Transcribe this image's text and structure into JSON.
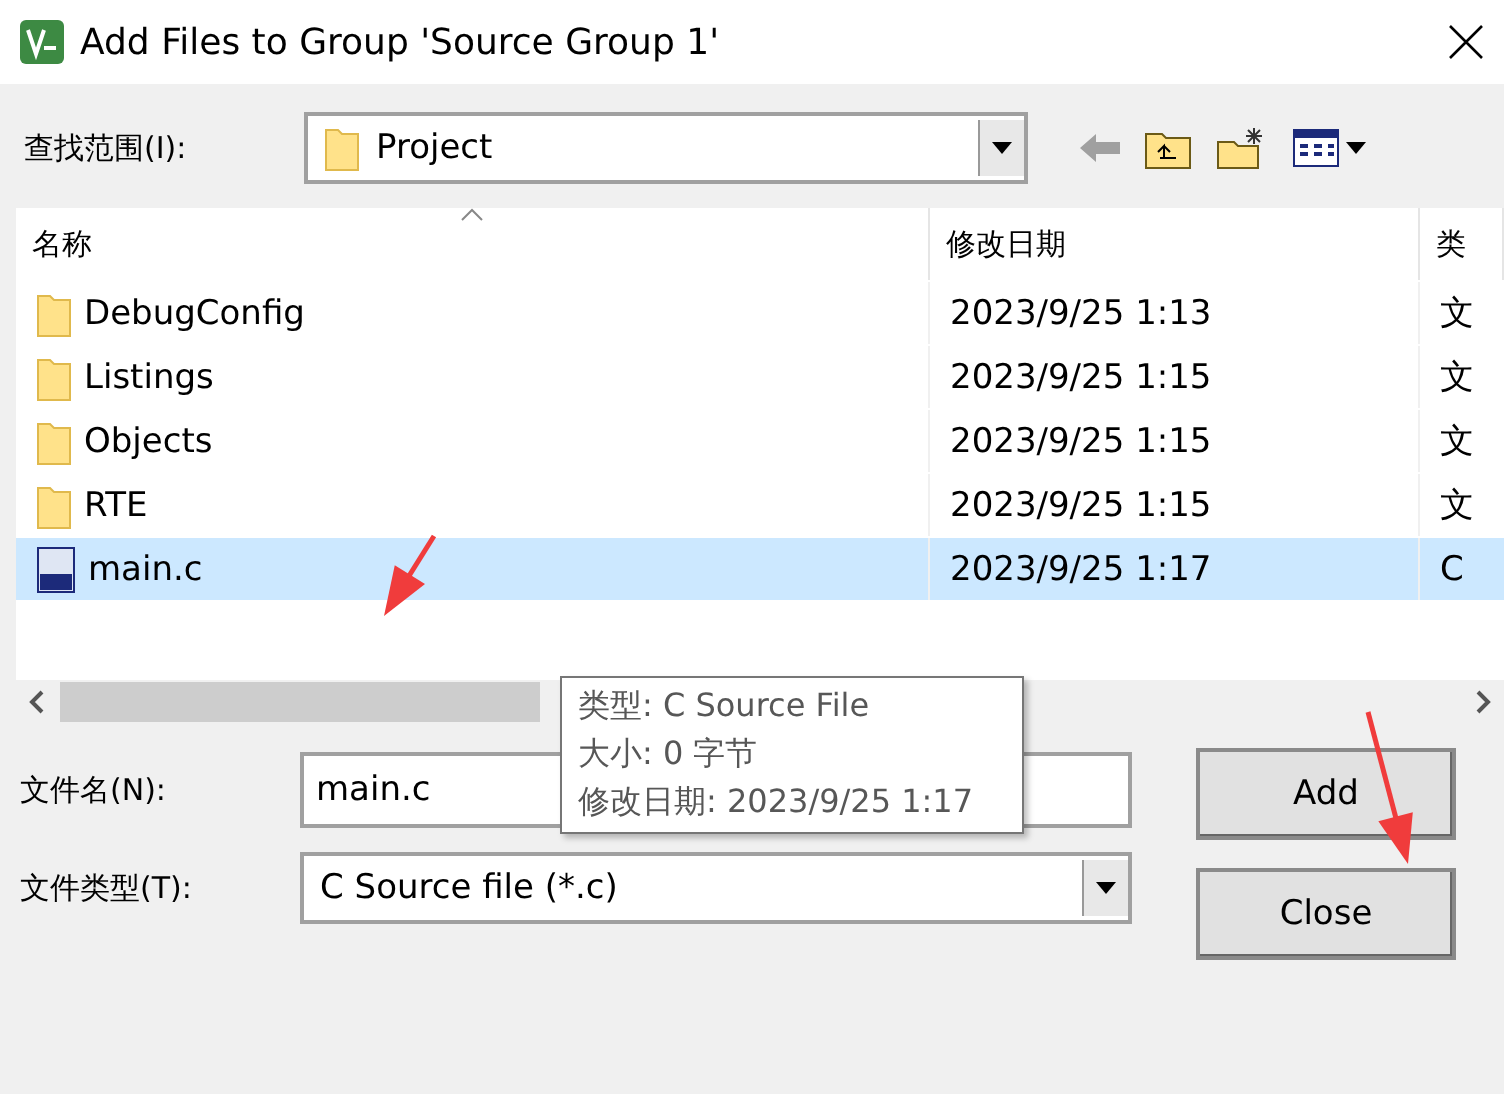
{
  "window": {
    "title": "Add Files to Group 'Source Group 1'"
  },
  "look_in": {
    "label": "查找范围(I):",
    "value": "Project"
  },
  "file_list": {
    "columns": [
      {
        "label": "名称",
        "sorted": true
      },
      {
        "label": "修改日期",
        "sorted": false
      },
      {
        "label": "类",
        "sorted": false
      }
    ],
    "rows": [
      {
        "kind": "folder",
        "name": "DebugConfig",
        "modified": "2023/9/25 1:13",
        "type": "文",
        "selected": false
      },
      {
        "kind": "folder",
        "name": "Listings",
        "modified": "2023/9/25 1:15",
        "type": "文",
        "selected": false
      },
      {
        "kind": "folder",
        "name": "Objects",
        "modified": "2023/9/25 1:15",
        "type": "文",
        "selected": false
      },
      {
        "kind": "folder",
        "name": "RTE",
        "modified": "2023/9/25 1:15",
        "type": "文",
        "selected": false
      },
      {
        "kind": "file",
        "name": "main.c",
        "modified": "2023/9/25 1:17",
        "type": "C",
        "selected": true
      }
    ]
  },
  "tooltip": {
    "lines": [
      "类型: C Source File",
      "大小: 0 字节",
      "修改日期: 2023/9/25 1:17"
    ]
  },
  "file_name": {
    "label": "文件名(N):",
    "value": "main.c"
  },
  "file_type": {
    "label": "文件类型(T):",
    "value": "C Source file (*.c)"
  },
  "buttons": [
    "Add",
    "Close"
  ]
}
